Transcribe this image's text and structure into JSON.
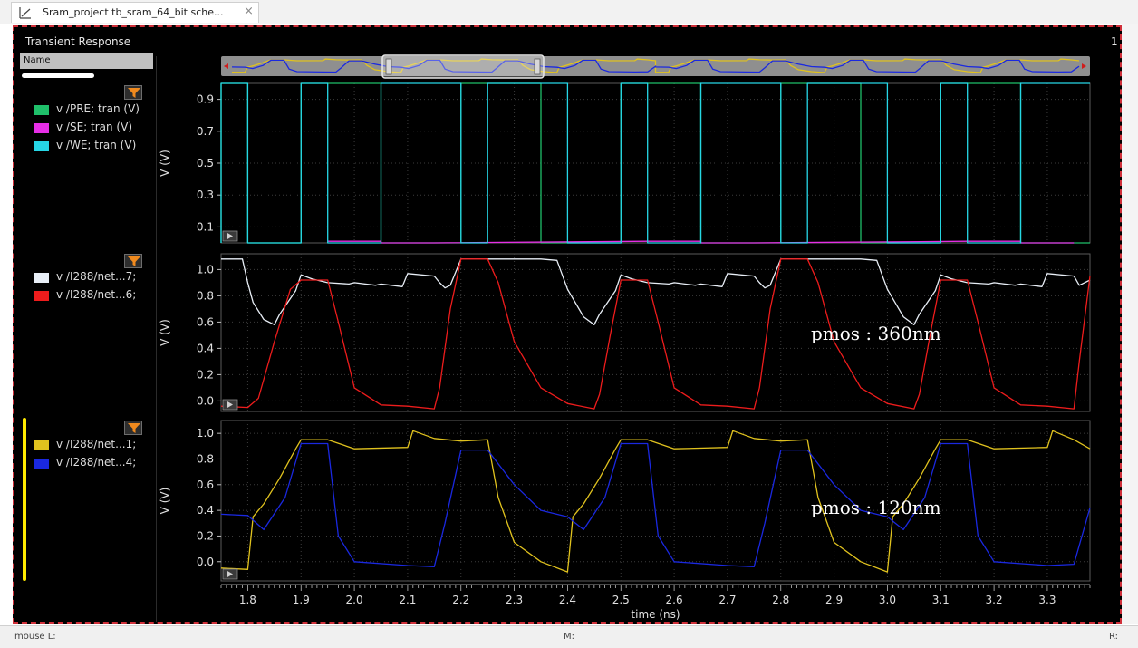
{
  "tab": {
    "title": "Sram_project tb_sram_64_bit sche...",
    "close": "×"
  },
  "panel": {
    "title": "Transient Response",
    "page_number": "1",
    "name_header": "Name"
  },
  "legends": {
    "p1": [
      {
        "label": "v /PRE; tran (V)",
        "color": "#1fbf6a"
      },
      {
        "label": "v /SE; tran (V)",
        "color": "#e62ee6"
      },
      {
        "label": "v /WE; tran (V)",
        "color": "#26d6e6"
      }
    ],
    "p2": [
      {
        "label": "v /I288/net...7;",
        "color": "#e8eef6"
      },
      {
        "label": "v /I288/net...6;",
        "color": "#ee1c1c"
      }
    ],
    "p3": [
      {
        "label": "v /I288/net...1;",
        "color": "#e0c21e"
      },
      {
        "label": "v /I288/net...4;",
        "color": "#1a28e0"
      }
    ]
  },
  "annotations": {
    "p2": "pmos : 360nm",
    "p3": "pmos : 120nm"
  },
  "status": {
    "left": "mouse L:",
    "mid": "M:",
    "right": "R:"
  },
  "chart_data": [
    {
      "type": "line",
      "xlabel": "",
      "ylabel": "V (V)",
      "xlim": [
        1.75,
        3.38
      ],
      "ylim": [
        0.0,
        1.0
      ],
      "yticks": [
        0.1,
        0.3,
        0.5,
        0.7,
        0.9
      ],
      "series": [
        {
          "name": "v /PRE; tran (V)",
          "color": "#1fbf6a",
          "x": [
            1.75,
            1.75,
            1.8,
            1.8,
            1.9,
            1.9,
            2.05,
            2.05,
            2.2,
            2.2,
            2.35,
            2.35,
            2.5,
            2.5,
            2.65,
            2.65,
            2.8,
            2.8,
            2.95,
            2.95,
            3.1,
            3.1,
            3.25,
            3.25,
            3.38
          ],
          "values": [
            0.0,
            1.0,
            1.0,
            0.0,
            0.0,
            1.0,
            1.0,
            0.0,
            0.0,
            1.0,
            1.0,
            0.0,
            0.0,
            1.0,
            1.0,
            0.0,
            0.0,
            1.0,
            1.0,
            0.0,
            0.0,
            1.0,
            1.0,
            0.0,
            0.0
          ]
        },
        {
          "name": "v /SE; tran (V)",
          "color": "#e62ee6",
          "x": [
            1.95,
            2.05,
            2.05,
            2.15,
            2.55,
            2.65,
            2.65,
            2.75,
            3.15,
            3.25,
            3.25,
            3.35
          ],
          "values": [
            0.01,
            0.01,
            0.0,
            0.0,
            0.01,
            0.01,
            0.0,
            0.0,
            0.01,
            0.01,
            0.0,
            0.0
          ]
        },
        {
          "name": "v /WE; tran (V)",
          "color": "#26d6e6",
          "x": [
            1.75,
            1.75,
            1.8,
            1.8,
            1.9,
            1.9,
            1.95,
            1.95,
            2.05,
            2.05,
            2.2,
            2.2,
            2.25,
            2.25,
            2.4,
            2.4,
            2.5,
            2.5,
            2.55,
            2.55,
            2.65,
            2.65,
            2.8,
            2.8,
            2.85,
            2.85,
            3.0,
            3.0,
            3.1,
            3.1,
            3.15,
            3.15,
            3.25,
            3.25,
            3.38
          ],
          "values": [
            0.0,
            1.0,
            1.0,
            0.0,
            0.0,
            1.0,
            1.0,
            0.0,
            0.0,
            1.0,
            1.0,
            0.0,
            0.0,
            1.0,
            1.0,
            0.0,
            0.0,
            1.0,
            1.0,
            0.0,
            0.0,
            1.0,
            1.0,
            0.0,
            0.0,
            1.0,
            1.0,
            0.0,
            0.0,
            1.0,
            1.0,
            0.0,
            0.0,
            1.0,
            1.0
          ]
        }
      ]
    },
    {
      "type": "line",
      "xlabel": "",
      "ylabel": "V (V)",
      "xlim": [
        1.75,
        3.38
      ],
      "ylim": [
        -0.08,
        1.12
      ],
      "yticks": [
        0.0,
        0.2,
        0.4,
        0.6,
        0.8,
        1.0
      ],
      "series": [
        {
          "name": "v /I288/net...7;",
          "color": "#e8eef6",
          "x": [
            1.75,
            1.79,
            1.8,
            1.81,
            1.83,
            1.85,
            1.86,
            1.89,
            1.9,
            1.92,
            1.95,
            1.99,
            2.0,
            2.04,
            2.05,
            2.09,
            2.1,
            2.15,
            2.16,
            2.17,
            2.18,
            2.2,
            2.35,
            2.38,
            2.4,
            2.43,
            2.45,
            2.46,
            2.49,
            2.5,
            2.52,
            2.55,
            2.59,
            2.6,
            2.64,
            2.65,
            2.69,
            2.7,
            2.75,
            2.76,
            2.77,
            2.78,
            2.8,
            2.95,
            2.98,
            3.0,
            3.03,
            3.05,
            3.06,
            3.09,
            3.1,
            3.12,
            3.15,
            3.19,
            3.2,
            3.24,
            3.25,
            3.29,
            3.3,
            3.35,
            3.36,
            3.38
          ],
          "values": [
            1.08,
            1.08,
            0.9,
            0.75,
            0.62,
            0.58,
            0.66,
            0.84,
            0.96,
            0.93,
            0.9,
            0.89,
            0.9,
            0.88,
            0.89,
            0.87,
            0.97,
            0.95,
            0.9,
            0.86,
            0.88,
            1.08,
            1.08,
            1.07,
            0.85,
            0.64,
            0.58,
            0.66,
            0.84,
            0.96,
            0.93,
            0.9,
            0.89,
            0.9,
            0.88,
            0.89,
            0.87,
            0.97,
            0.95,
            0.9,
            0.86,
            0.88,
            1.08,
            1.08,
            1.07,
            0.85,
            0.64,
            0.58,
            0.66,
            0.84,
            0.96,
            0.93,
            0.9,
            0.89,
            0.9,
            0.88,
            0.89,
            0.87,
            0.97,
            0.95,
            0.88,
            0.92
          ]
        },
        {
          "name": "v /I288/net...6;",
          "color": "#ee1c1c",
          "x": [
            1.75,
            1.8,
            1.82,
            1.85,
            1.88,
            1.9,
            1.95,
            1.97,
            2.0,
            2.05,
            2.1,
            2.15,
            2.16,
            2.18,
            2.2,
            2.25,
            2.27,
            2.3,
            2.35,
            2.4,
            2.45,
            2.46,
            2.48,
            2.5,
            2.55,
            2.57,
            2.6,
            2.65,
            2.7,
            2.75,
            2.76,
            2.78,
            2.8,
            2.85,
            2.87,
            2.9,
            2.95,
            3.0,
            3.05,
            3.06,
            3.08,
            3.1,
            3.15,
            3.17,
            3.2,
            3.25,
            3.3,
            3.35,
            3.36,
            3.38
          ],
          "values": [
            -0.04,
            -0.05,
            0.02,
            0.45,
            0.85,
            0.92,
            0.92,
            0.6,
            0.1,
            -0.03,
            -0.04,
            -0.06,
            0.1,
            0.7,
            1.08,
            1.08,
            0.9,
            0.45,
            0.1,
            -0.02,
            -0.06,
            0.05,
            0.5,
            0.92,
            0.92,
            0.6,
            0.1,
            -0.03,
            -0.04,
            -0.06,
            0.1,
            0.7,
            1.08,
            1.08,
            0.9,
            0.45,
            0.1,
            -0.02,
            -0.06,
            0.05,
            0.5,
            0.92,
            0.92,
            0.6,
            0.1,
            -0.03,
            -0.04,
            -0.06,
            0.3,
            0.95
          ]
        }
      ]
    },
    {
      "type": "line",
      "xlabel": "time (ns)",
      "ylabel": "V (V)",
      "xlim": [
        1.75,
        3.38
      ],
      "ylim": [
        -0.15,
        1.1
      ],
      "xticks": [
        1.8,
        1.9,
        2.0,
        2.1,
        2.2,
        2.3,
        2.4,
        2.5,
        2.6,
        2.7,
        2.8,
        2.9,
        3.0,
        3.1,
        3.2,
        3.3
      ],
      "yticks": [
        0.0,
        0.2,
        0.4,
        0.6,
        0.8,
        1.0
      ],
      "series": [
        {
          "name": "v /I288/net...1;",
          "color": "#e0c21e",
          "x": [
            1.75,
            1.8,
            1.81,
            1.83,
            1.86,
            1.89,
            1.9,
            1.95,
            2.0,
            2.1,
            2.11,
            2.15,
            2.2,
            2.25,
            2.27,
            2.3,
            2.35,
            2.4,
            2.41,
            2.43,
            2.46,
            2.49,
            2.5,
            2.55,
            2.6,
            2.7,
            2.71,
            2.75,
            2.8,
            2.85,
            2.87,
            2.9,
            2.95,
            3.0,
            3.01,
            3.03,
            3.06,
            3.09,
            3.1,
            3.15,
            3.2,
            3.3,
            3.31,
            3.35,
            3.38
          ],
          "values": [
            -0.05,
            -0.06,
            0.35,
            0.45,
            0.65,
            0.88,
            0.95,
            0.95,
            0.88,
            0.89,
            1.02,
            0.96,
            0.94,
            0.95,
            0.5,
            0.15,
            0.0,
            -0.08,
            0.35,
            0.45,
            0.65,
            0.88,
            0.95,
            0.95,
            0.88,
            0.89,
            1.02,
            0.96,
            0.94,
            0.95,
            0.5,
            0.15,
            0.0,
            -0.08,
            0.35,
            0.45,
            0.65,
            0.88,
            0.95,
            0.95,
            0.88,
            0.89,
            1.02,
            0.95,
            0.88
          ]
        },
        {
          "name": "v /I288/net...4;",
          "color": "#1a28e0",
          "x": [
            1.75,
            1.8,
            1.83,
            1.87,
            1.9,
            1.95,
            1.97,
            2.0,
            2.1,
            2.15,
            2.17,
            2.2,
            2.25,
            2.3,
            2.35,
            2.4,
            2.43,
            2.47,
            2.5,
            2.55,
            2.57,
            2.6,
            2.7,
            2.75,
            2.77,
            2.8,
            2.85,
            2.9,
            2.95,
            3.0,
            3.03,
            3.07,
            3.1,
            3.15,
            3.17,
            3.2,
            3.3,
            3.35,
            3.38
          ],
          "values": [
            0.37,
            0.36,
            0.25,
            0.5,
            0.92,
            0.92,
            0.2,
            0.0,
            -0.03,
            -0.04,
            0.3,
            0.87,
            0.87,
            0.6,
            0.4,
            0.35,
            0.25,
            0.5,
            0.92,
            0.92,
            0.2,
            0.0,
            -0.03,
            -0.04,
            0.3,
            0.87,
            0.87,
            0.6,
            0.4,
            0.35,
            0.25,
            0.5,
            0.92,
            0.92,
            0.2,
            0.0,
            -0.03,
            -0.02,
            0.42
          ]
        }
      ]
    }
  ]
}
